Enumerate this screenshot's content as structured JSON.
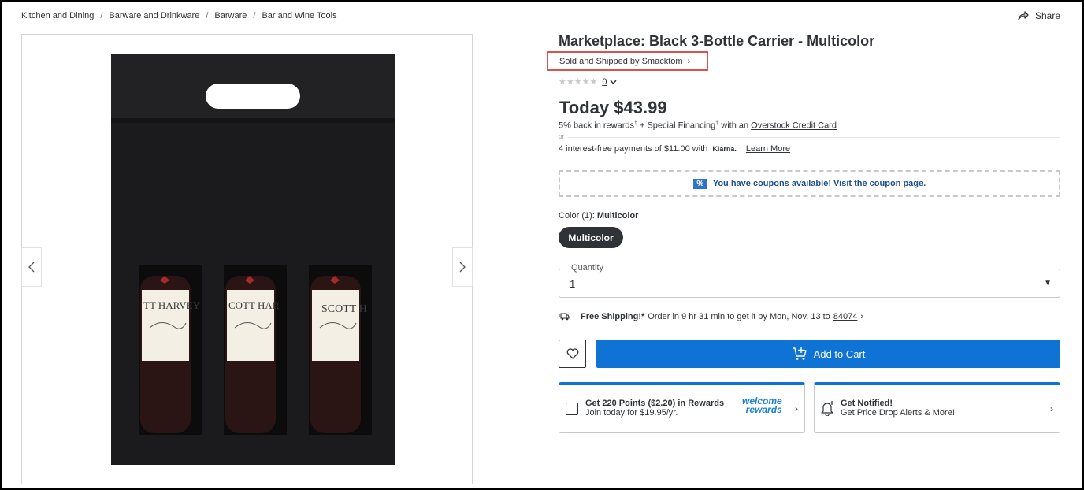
{
  "breadcrumb": {
    "items": [
      "Kitchen and Dining",
      "Barware and Drinkware",
      "Barware",
      "Bar and Wine Tools"
    ],
    "separator": "/"
  },
  "share_label": "Share",
  "product": {
    "title": "Marketplace: Black 3-Bottle Carrier - Multicolor",
    "seller": "Sold and Shipped by Smacktom",
    "stars": "★★★★★",
    "review_count": "0",
    "price": "Today $43.99",
    "bottle_labels": [
      "TT HARVEY",
      "COTT HAR",
      "SCOTT H"
    ]
  },
  "rewards": {
    "text_before": "5% back in rewards",
    "text_middle": " + Special Financing",
    "text_after": " with an ",
    "link": "Overstock Credit Card"
  },
  "or_label": "or",
  "klarna": {
    "text": "4 interest-free payments of $11.00 with",
    "brand": "Klarna.",
    "link": "Learn More"
  },
  "coupon": {
    "icon": "%",
    "text": "You have coupons available! Visit the coupon page."
  },
  "color": {
    "label": "Color (1):",
    "value": "Multicolor",
    "option": "Multicolor"
  },
  "quantity": {
    "label": "Quantity",
    "value": "1",
    "caret": "▼"
  },
  "shipping": {
    "bold": "Free Shipping!*",
    "text": "Order in 9 hr 31 min to get it by Mon, Nov. 13 to",
    "zip": "84074"
  },
  "cart": {
    "add_label": "Add to Cart"
  },
  "rewards_card": {
    "title": "Get 220 Points ($2.20) in Rewards",
    "sub": "Join today for $19.95/yr.",
    "brand_line1": "welcome",
    "brand_line2": "rewards"
  },
  "notify_card": {
    "title": "Get Notified!",
    "sub": "Get Price Drop Alerts & More!"
  },
  "colors": {
    "accent": "#0e73d4",
    "highlight_border": "#d9534f",
    "text": "#2f3337"
  }
}
